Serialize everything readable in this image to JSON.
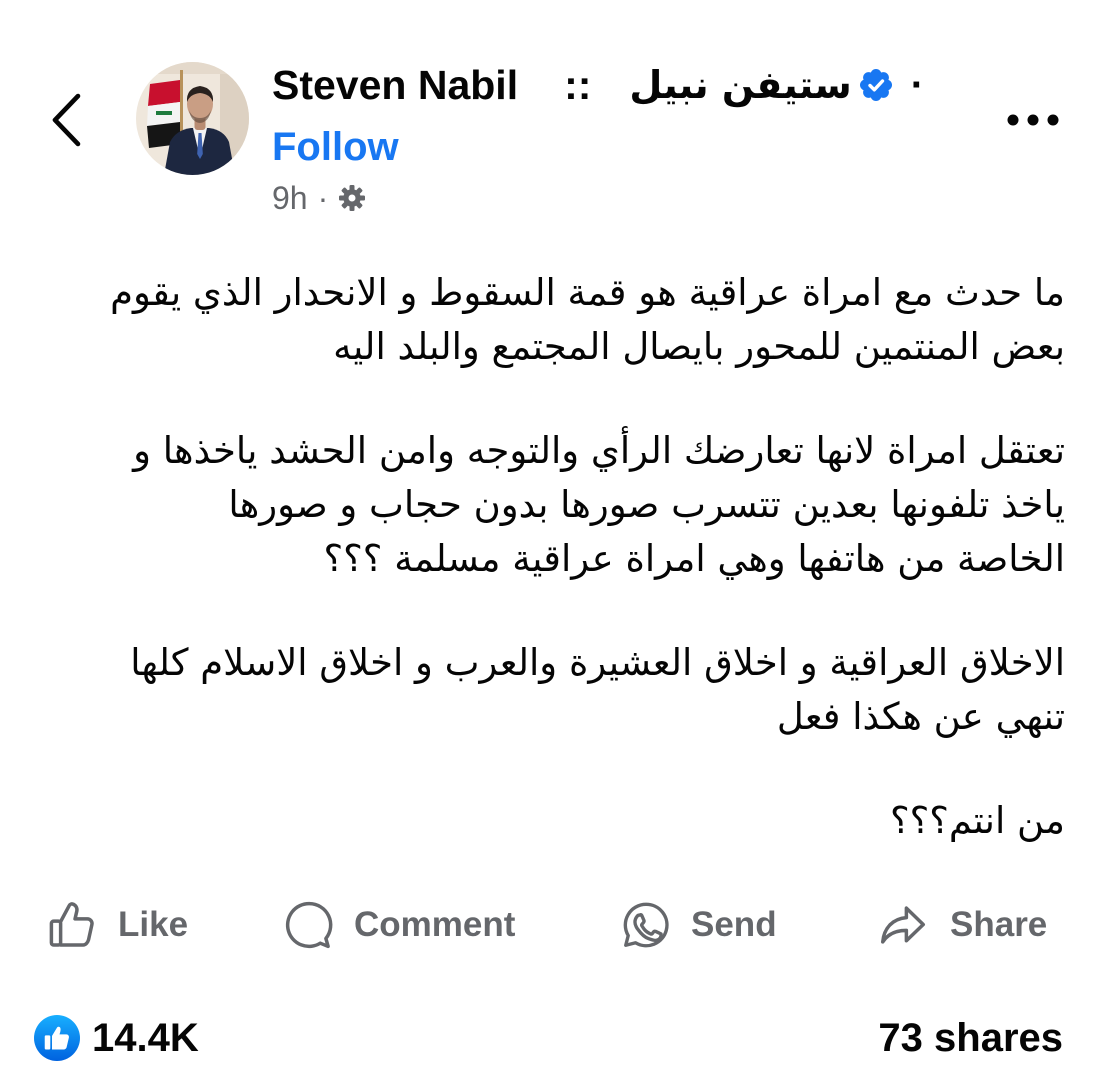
{
  "colors": {
    "background": "#ffffff",
    "text": "#050505",
    "secondary": "#65676b",
    "link": "#1877f2",
    "verified": "#1877f2",
    "reaction": "#0866ff"
  },
  "header": {
    "back_icon": "chevron-left-icon",
    "more_icon": "more-horizontal-icon"
  },
  "post": {
    "author": {
      "name_latin": "Steven Nabil",
      "name_separator": "::",
      "name_arabic": "ستيفن نبيل",
      "verified_icon": "verified-badge-icon",
      "trailing_dot": "·",
      "follow_label": "Follow"
    },
    "meta": {
      "time": "9h",
      "dot": "·",
      "audience_icon": "gear-icon"
    },
    "body": {
      "paragraphs": [
        [
          "ما حدث مع امراة عراقية هو قمة السقوط و الانحدار الذي يقوم",
          "بعض المنتمين للمحور بايصال المجتمع والبلد اليه"
        ],
        [
          "تعتقل امراة لانها تعارضك الرأي والتوجه وامن الحشد ياخذها و",
          "ياخذ تلفونها بعدين تتسرب صورها بدون حجاب و صورها",
          "الخاصة من هاتفها وهي امراة عراقية مسلمة ؟؟؟"
        ],
        [
          "الاخلاق العراقية و اخلاق العشيرة والعرب و اخلاق الاسلام كلها",
          "تنهي عن هكذا فعل"
        ],
        [
          "من انتم؟؟؟"
        ]
      ]
    }
  },
  "actions": [
    {
      "label": "Like",
      "icon": "thumbs-up-icon"
    },
    {
      "label": "Comment",
      "icon": "comment-icon"
    },
    {
      "label": "Send",
      "icon": "whatsapp-send-icon"
    },
    {
      "label": "Share",
      "icon": "share-arrow-icon"
    }
  ],
  "stats": {
    "reaction_icon": "like-reaction-icon",
    "reaction_count": "14.4K",
    "shares": "73 shares"
  }
}
